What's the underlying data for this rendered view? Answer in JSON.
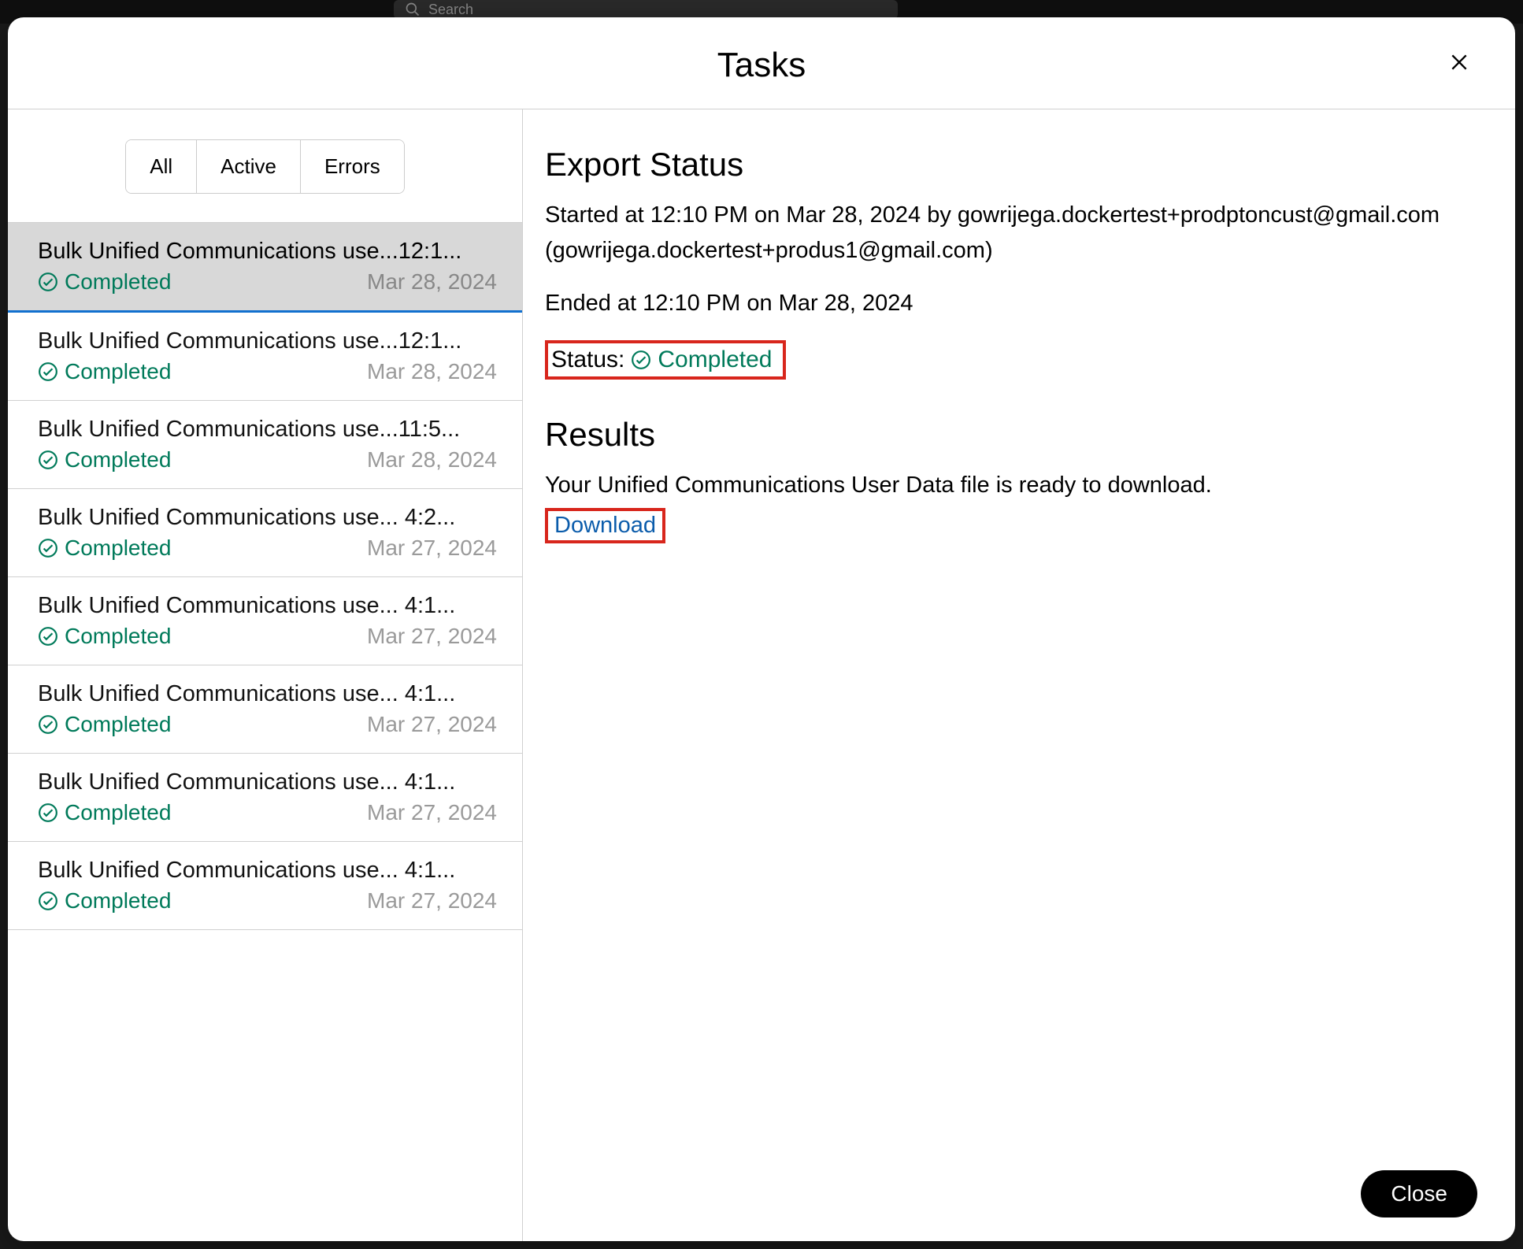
{
  "backdrop": {
    "search_placeholder": "Search"
  },
  "modal": {
    "title": "Tasks",
    "close_label": "Close"
  },
  "filters": {
    "all": "All",
    "active": "Active",
    "errors": "Errors"
  },
  "status_word": "Completed",
  "tasks": [
    {
      "title": "Bulk Unified Communications use...12:1...",
      "status": "Completed",
      "date": "Mar 28, 2024",
      "selected": true
    },
    {
      "title": "Bulk Unified Communications use...12:1...",
      "status": "Completed",
      "date": "Mar 28, 2024",
      "selected": false
    },
    {
      "title": "Bulk Unified Communications use...11:5...",
      "status": "Completed",
      "date": "Mar 28, 2024",
      "selected": false
    },
    {
      "title": "Bulk Unified Communications use... 4:2...",
      "status": "Completed",
      "date": "Mar 27, 2024",
      "selected": false
    },
    {
      "title": "Bulk Unified Communications use... 4:1...",
      "status": "Completed",
      "date": "Mar 27, 2024",
      "selected": false
    },
    {
      "title": "Bulk Unified Communications use... 4:1...",
      "status": "Completed",
      "date": "Mar 27, 2024",
      "selected": false
    },
    {
      "title": "Bulk Unified Communications use... 4:1...",
      "status": "Completed",
      "date": "Mar 27, 2024",
      "selected": false
    },
    {
      "title": "Bulk Unified Communications use... 4:1...",
      "status": "Completed",
      "date": "Mar 27, 2024",
      "selected": false
    }
  ],
  "detail": {
    "heading": "Export Status",
    "started_line": "Started at 12:10 PM on Mar 28, 2024 by gowrijega.dockertest+prodptoncust@gmail.com (gowrijega.dockertest+produs1@gmail.com)",
    "ended_line": "Ended at 12:10 PM on Mar 28, 2024",
    "status_label": "Status:",
    "status_value": "Completed",
    "results_heading": "Results",
    "results_text": "Your Unified Communications User Data file is ready to download.",
    "download_label": "Download"
  }
}
